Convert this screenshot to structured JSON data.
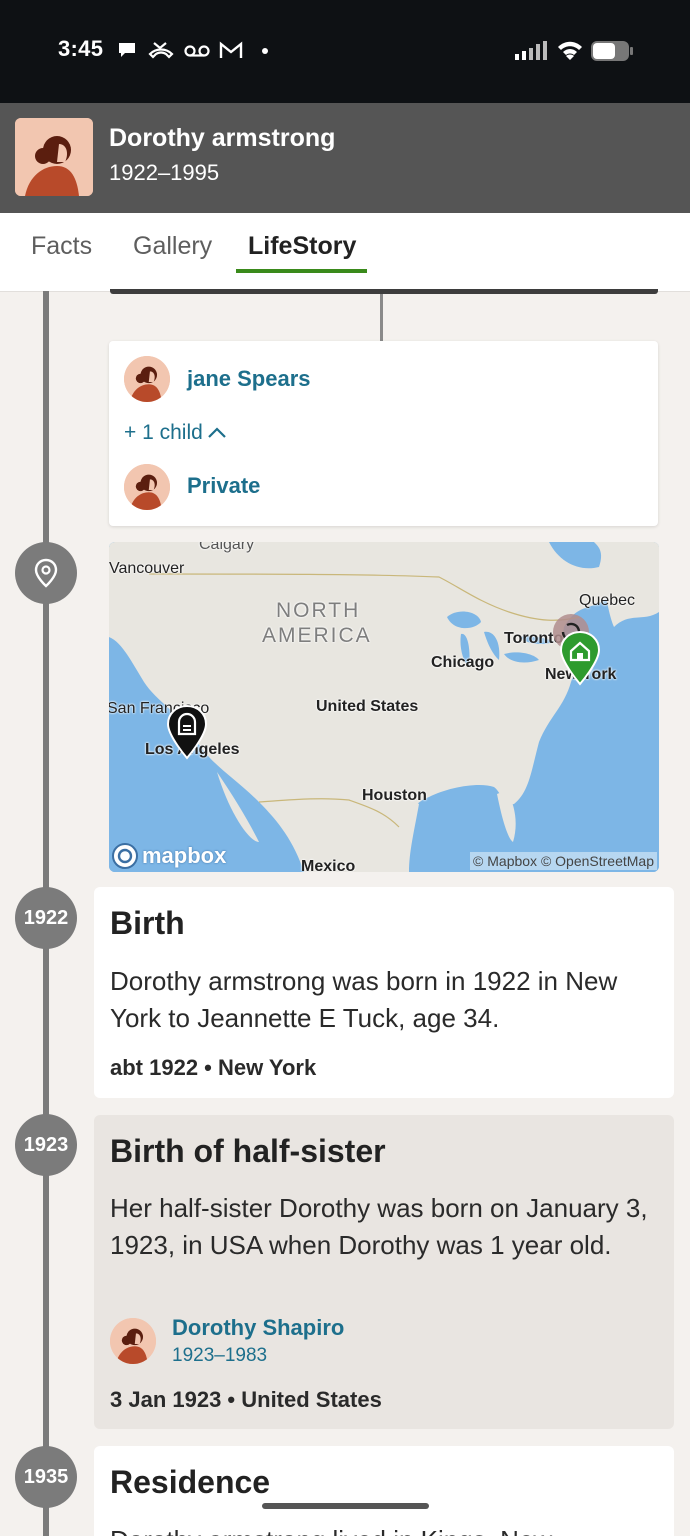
{
  "status_bar": {
    "time": "3:45"
  },
  "profile": {
    "name": "Dorothy armstrong",
    "years": "1922–1995"
  },
  "tabs": [
    {
      "label": "Facts"
    },
    {
      "label": "Gallery"
    },
    {
      "label": "LifeStory",
      "active": true
    }
  ],
  "family": {
    "spouse": "jane Spears",
    "children_toggle": "+ 1 child",
    "child": "Private"
  },
  "map": {
    "labels": {
      "calgary": "Calgary",
      "vancouver": "Vancouver",
      "north_america_1": "NORTH",
      "north_america_2": "AMERICA",
      "quebec": "Quebec",
      "toronto": "Toronto",
      "chicago": "Chicago",
      "new_york": "New York",
      "san_francisco": "San Francisco",
      "united_states": "United States",
      "los_angeles": "Los Angeles",
      "houston": "Houston",
      "mexico": "Mexico"
    },
    "logo": "mapbox",
    "attribution": "© Mapbox © OpenStreetMap"
  },
  "events": [
    {
      "year": "1922",
      "title": "Birth",
      "description": "Dorothy armstrong was born in 1922 in New York to Jeannette E Tuck, age 34.",
      "meta": "abt 1922 • New York"
    },
    {
      "year": "1923",
      "title": "Birth of half-sister",
      "description": "Her half-sister Dorothy was born on January 3, 1923, in USA when Dorothy was 1 year old.",
      "person_name": "Dorothy Shapiro",
      "person_years": "1923–1983",
      "meta": "3 Jan 1923 • United States"
    },
    {
      "year": "1935",
      "title": "Residence",
      "description": "Dorothy armstrong lived in Kings, New"
    }
  ],
  "colors": {
    "accent_green": "#3a8a1b",
    "link_blue": "#1d6f8c",
    "timeline_gray": "#7b7b7b",
    "header_gray": "#555555"
  }
}
